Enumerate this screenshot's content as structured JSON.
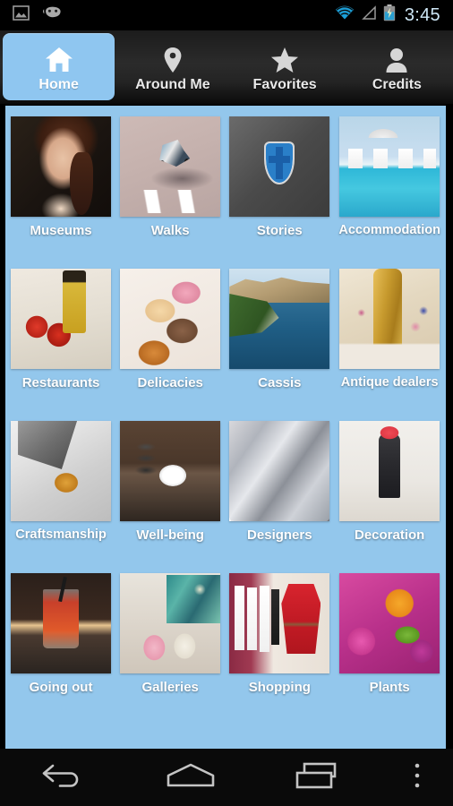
{
  "status_bar": {
    "time": "3:45",
    "icons": [
      "image-icon",
      "android-robot-icon",
      "wifi-icon",
      "cellular-signal-icon",
      "battery-charging-icon"
    ]
  },
  "tabs": [
    {
      "label": "Home",
      "icon": "home-icon",
      "active": true
    },
    {
      "label": "Around Me",
      "icon": "map-pin-icon",
      "active": false
    },
    {
      "label": "Favorites",
      "icon": "star-icon",
      "active": false
    },
    {
      "label": "Credits",
      "icon": "person-icon",
      "active": false
    }
  ],
  "grid": {
    "items": [
      {
        "label": "Museums",
        "art": "a-museum",
        "thumb": "portrait-painting-thumbnail"
      },
      {
        "label": "Walks",
        "art": "a-walks",
        "thumb": "cyclist-aerial-thumbnail"
      },
      {
        "label": "Stories",
        "art": "a-stories",
        "thumb": "coat-of-arms-thumbnail"
      },
      {
        "label": "Accommodation",
        "art": "a-accom",
        "thumb": "swimming-pool-thumbnail"
      },
      {
        "label": "Restaurants",
        "art": "a-rest",
        "thumb": "tomatoes-olive-oil-thumbnail"
      },
      {
        "label": "Delicacies",
        "art": "a-delic",
        "thumb": "macarons-thumbnail"
      },
      {
        "label": "Cassis",
        "art": "a-cassis",
        "thumb": "coastal-cliffs-thumbnail"
      },
      {
        "label": "Antique dealers",
        "art": "a-antique",
        "thumb": "gilt-antiques-thumbnail"
      },
      {
        "label": "Craftsmanship",
        "art": "a-craft",
        "thumb": "artisan-hands-thumbnail"
      },
      {
        "label": "Well-being",
        "art": "a-well",
        "thumb": "spa-stones-thumbnail"
      },
      {
        "label": "Designers",
        "art": "a-design",
        "thumb": "silver-crystal-thumbnail"
      },
      {
        "label": "Decoration",
        "art": "a-decor",
        "thumb": "interior-room-thumbnail"
      },
      {
        "label": "Going out",
        "art": "a-goingout",
        "thumb": "cocktail-bar-thumbnail"
      },
      {
        "label": "Galleries",
        "art": "a-galler",
        "thumb": "ceramic-vases-thumbnail"
      },
      {
        "label": "Shopping",
        "art": "a-shop",
        "thumb": "clothing-rack-thumbnail"
      },
      {
        "label": "Plants",
        "art": "a-plants",
        "thumb": "flowers-thumbnail"
      }
    ]
  },
  "nav_bar": {
    "buttons": [
      {
        "name": "back-button",
        "icon": "back-arrow-icon"
      },
      {
        "name": "home-button",
        "icon": "home-pentagon-icon"
      },
      {
        "name": "recents-button",
        "icon": "recent-apps-icon"
      },
      {
        "name": "menu-button",
        "icon": "overflow-menu-icon"
      }
    ]
  },
  "colors": {
    "accent_blue": "#8fc6f0",
    "content_background": "#93c7ec",
    "tab_bar_dark": "#2b2b2b",
    "status_time": "#cfe8f7",
    "label_white": "#ffffff"
  }
}
